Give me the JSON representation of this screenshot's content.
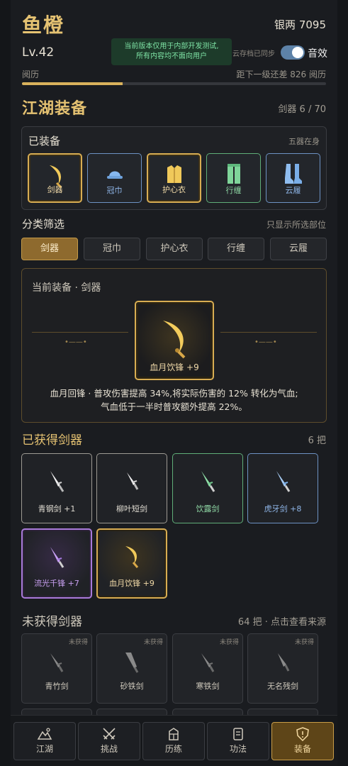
{
  "header": {
    "title": "鱼橙",
    "money": "银两 7095",
    "level": "Lv.42",
    "toast_line1": "当前版本仅用于内部开发测试,",
    "toast_line2": "所有内容均不面向用户",
    "sync_status": "云存档已同步",
    "sound_label": "音效",
    "sound_on": true,
    "xp_label": "阅历",
    "xp_remaining": "距下一级还差 826 阅历",
    "xp_progress": 0.33
  },
  "equip_section": {
    "title": "江湖装备",
    "count": "剑器 6 / 70"
  },
  "equipped": {
    "title": "已装备",
    "note": "五器在身",
    "slots": [
      {
        "label": "剑器",
        "icon": "crescent-blade-icon",
        "rarity": "gold"
      },
      {
        "label": "冠巾",
        "icon": "hat-icon",
        "rarity": "blue"
      },
      {
        "label": "护心衣",
        "icon": "armor-vest-icon",
        "rarity": "gold"
      },
      {
        "label": "行缠",
        "icon": "leggings-icon",
        "rarity": "green"
      },
      {
        "label": "云履",
        "icon": "boots-icon",
        "rarity": "blue"
      }
    ]
  },
  "filter": {
    "title": "分类筛选",
    "note": "只显示所选部位",
    "chips": [
      "剑器",
      "冠巾",
      "护心衣",
      "行缠",
      "云履"
    ],
    "active": 0
  },
  "current": {
    "title": "当前装备 · 剑器",
    "name": "血月饮锋 +9",
    "desc_line1": "血月回锋 · 普攻伤害提高 34%,将实际伤害的 12% 转化为气血;",
    "desc_line2": "气血低于一半时普攻额外提高 22%。"
  },
  "obtained": {
    "title": "已获得剑器",
    "count": "6 把",
    "items": [
      {
        "name": "青钢剑 +1",
        "rarity": "white"
      },
      {
        "name": "柳叶短剑",
        "rarity": "white"
      },
      {
        "name": "饮露剑",
        "rarity": "green"
      },
      {
        "name": "虎牙剑 +8",
        "rarity": "blue"
      },
      {
        "name": "流光千锋 +7",
        "rarity": "purple"
      },
      {
        "name": "血月饮锋 +9",
        "rarity": "gold"
      }
    ]
  },
  "unobtained": {
    "title": "未获得剑器",
    "note": "64 把 · 点击查看来源",
    "tag": "未获得",
    "items": [
      "青竹剑",
      "砂铁剑",
      "寒铁剑",
      "无名残剑"
    ]
  },
  "nav": {
    "items": [
      {
        "label": "江湖",
        "icon": "mountain-icon"
      },
      {
        "label": "挑战",
        "icon": "crossed-swords-icon"
      },
      {
        "label": "历练",
        "icon": "lantern-icon"
      },
      {
        "label": "功法",
        "icon": "scroll-icon"
      },
      {
        "label": "装备",
        "icon": "shield-icon"
      }
    ],
    "active": 4
  },
  "colors": {
    "gold": "#e2be6a",
    "white": "#d6d2c8",
    "green": "#7fd59a",
    "blue": "#86aee6",
    "purple": "#c08cf0"
  }
}
